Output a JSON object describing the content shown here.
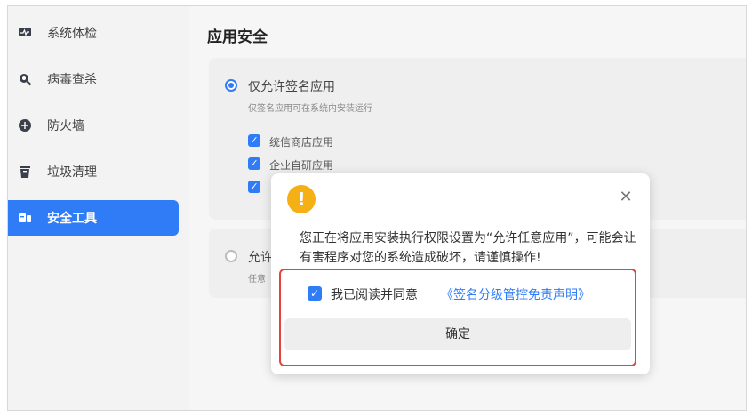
{
  "sidebar": {
    "items": [
      {
        "label": "系统体检",
        "icon": "monitor-icon",
        "active": false
      },
      {
        "label": "病毒查杀",
        "icon": "virus-scan-icon",
        "active": false
      },
      {
        "label": "防火墙",
        "icon": "firewall-icon",
        "active": false
      },
      {
        "label": "垃圾清理",
        "icon": "trash-icon",
        "active": false
      },
      {
        "label": "安全工具",
        "icon": "tools-icon",
        "active": true
      }
    ]
  },
  "main": {
    "title": "应用安全",
    "option1": {
      "title": "仅允许签名应用",
      "desc": "仅签名应用可在系统内安装运行",
      "checkboxes": [
        "统信商店应用",
        "企业自研应用",
        ""
      ]
    },
    "option2": {
      "title": "允许",
      "desc": "任意"
    }
  },
  "dialog": {
    "message": "您正在将应用安装执行权限设置为“允许任意应用”，可能会让有害程序对您的系统造成破坏，请谨慎操作!",
    "agree_label": "我已阅读并同意",
    "agree_link": "《签名分级管控免责声明》",
    "ok_label": "确定"
  },
  "colors": {
    "accent": "#2f7cf6",
    "warning": "#f5b015",
    "highlight": "#e5443a"
  }
}
